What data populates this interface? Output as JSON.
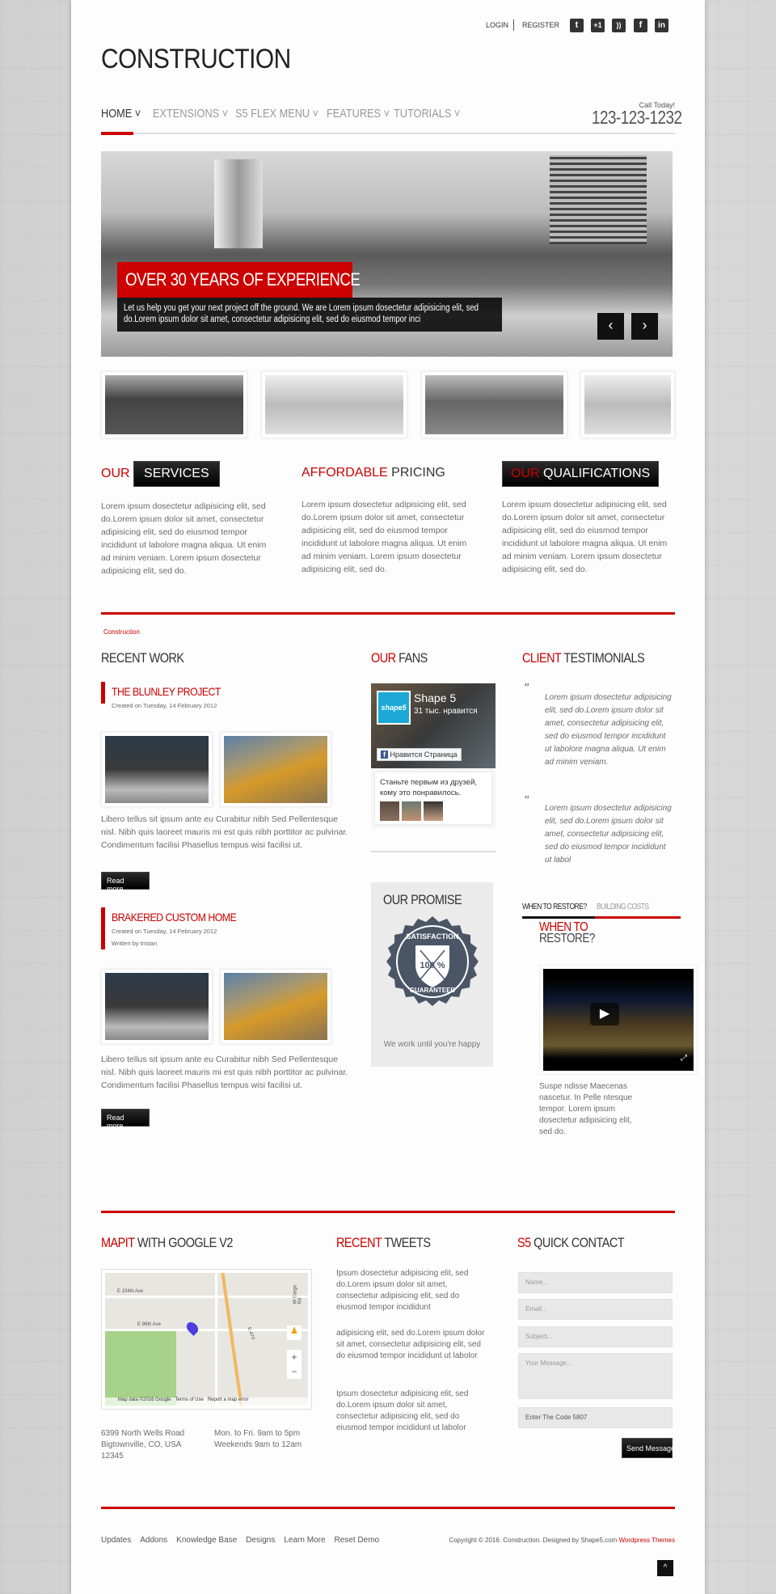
{
  "header": {
    "login": "LOGIN",
    "register": "REGISTER",
    "social": [
      "twitter-icon",
      "google-plus-icon",
      "rss-icon",
      "facebook-icon",
      "linkedin-icon"
    ],
    "logo": "CONSTRUCTION",
    "call_label": "Call Today!",
    "phone": "123-123-1232"
  },
  "nav": [
    {
      "label": "HOME",
      "active": true
    },
    {
      "label": "EXTENSIONS"
    },
    {
      "label": "S5 FLEX MENU"
    },
    {
      "label": "FEATURES"
    },
    {
      "label": "TUTORIALS"
    }
  ],
  "hero": {
    "title": "OVER 30 YEARS OF EXPERIENCE",
    "text": "Let us help you get your next project off the ground. We are Lorem ipsum dosectetur adipisicing elit, sed do.Lorem ipsum dolor sit amet, consectetur adipisicing elit, sed do eiusmod tempor inci"
  },
  "features": [
    {
      "accent": "OUR",
      "title": "SERVICES",
      "text": "Lorem ipsum dosectetur adipisicing elit, sed do.Lorem ipsum dolor sit amet, consectetur adipisicing elit, sed do eiusmod tempor incididunt ut labolore magna aliqua. Ut enim ad minim veniam. Lorem ipsum dosectetur adipisicing elit, sed do."
    },
    {
      "accent": "AFFORDABLE",
      "title": "PRICING",
      "text": "Lorem ipsum dosectetur adipisicing elit, sed do.Lorem ipsum dolor sit amet, consectetur adipisicing elit, sed do eiusmod tempor incididunt ut labolore magna aliqua. Ut enim ad minim veniam. Lorem ipsum dosectetur adipisicing elit, sed do."
    },
    {
      "accent": "OUR",
      "title": "QUALIFICATIONS",
      "text": "Lorem ipsum dosectetur adipisicing elit, sed do.Lorem ipsum dolor sit amet, consectetur adipisicing elit, sed do eiusmod tempor incididunt ut labolore magna aliqua. Ut enim ad minim veniam. Lorem ipsum dosectetur adipisicing elit, sed do."
    }
  ],
  "breadcrumb": "Construction",
  "recent_work": {
    "title": "RECENT WORK",
    "items": [
      {
        "title": "THE BLUNLEY PROJECT",
        "date": "Created on Tuesday, 14 February 2012",
        "text": "Libero tellus sit ipsum ante eu Curabitur nibh Sed Pellentesque nisl. Nibh quis laoreet mauris mi est quis nibh porttitor ac pulvinar. Condimentum facilisi Phasellus tempus wisi facilisi ut.",
        "button": "Read more..."
      },
      {
        "title": "BRAKERED CUSTOM HOME",
        "date": "Created on Tuesday, 14 February 2012",
        "author": "Written by tristan",
        "text": "Libero tellus sit ipsum ante eu Curabitur nibh Sed Pellentesque nisl. Nibh quis laoreet mauris mi est quis nibh porttitor ac pulvinar. Condimentum facilisi Phasellus tempus wisi facilisi ut.",
        "button": "Read more..."
      }
    ]
  },
  "fans": {
    "accent": "OUR",
    "title": "FANS",
    "page_name": "Shape 5",
    "likes": "31 тыс. нравится",
    "logo_text": "shape5",
    "like_button": "Нравится Страница",
    "friends_text": "Станьте первым из друзей, кому это понравилось."
  },
  "promise": {
    "title": "OUR PROMISE",
    "badge_top": "SATISFACTION",
    "badge_bottom": "GUARANTEED",
    "badge_mid": "100 %",
    "text": "We work until you're happy"
  },
  "testimonials": {
    "accent": "CLIENT",
    "title": "TESTIMONIALS",
    "items": [
      "Lorem ipsum dosectetur adipisicing elit, sed do.Lorem ipsum dolor sit amet, consectetur adipisicing elit, sed do eiusmod tempor incididunt ut labolore magna aliqua. Ut enim ad minim veniam.",
      "Lorem ipsum dosectetur adipisicing elit, sed do.Lorem ipsum dolor sit amet, consectetur adipisicing elit, sed do eiusmod tempor incididunt ut labol"
    ]
  },
  "tabs": {
    "items": [
      "WHEN TO RESTORE?",
      "BUILDING COSTS"
    ],
    "active": 0,
    "heading_accent": "WHEN TO",
    "heading": "RESTORE?",
    "text": "Suspe ndisse Maecenas nascetur. In Pelle ntesque tempor. Lorem ipsum dosectetur adipisicing elit, sed do."
  },
  "map": {
    "accent": "MAPIT",
    "title": "WITH GOOGLE V2",
    "labels": [
      "E 104th Ave",
      "E 96th Ave",
      "W Cargo Rd",
      "E-470"
    ],
    "attribution": "Map data ©2016 Google",
    "terms": "Terms of Use",
    "report": "Report a map error",
    "address": [
      "6399 North Wells Road",
      "Bigtownville, CO, USA",
      "12345"
    ],
    "hours": [
      "Mon. to Fri. 9am to 5pm",
      "Weekends 9am to 12am"
    ]
  },
  "tweets": {
    "accent": "RECENT",
    "title": "TWEETS",
    "items": [
      "Ipsum dosectetur adipisicing elit, sed do.Lorem ipsum dolor sit amet, consectetur adipisicing elit, sed do eiusmod tempor incididunt",
      "adipisicing elit, sed do.Lorem ipsum dolor sit amet, consectetur adipisicing elit, sed do eiusmod tempor incididunt ut labolor",
      "Ipsum dosectetur adipisicing elit, sed do.Lorem ipsum dolor sit amet, consectetur adipisicing elit, sed do eiusmod tempor incididunt ut labolor"
    ]
  },
  "contact": {
    "accent": "S5",
    "title": "QUICK CONTACT",
    "name": "Name...",
    "email": "Email...",
    "subject": "Subject...",
    "message": "Your Message...",
    "code": "Enter The Code 5807",
    "send": "Send Message"
  },
  "footer": {
    "links": [
      "Updates",
      "Addons",
      "Knowledge Base",
      "Designs",
      "Learn More",
      "Reset Demo"
    ],
    "copyright": "Copyright © 2016. Construction. Designed by Shape5.com",
    "copyright_link": "Wordpress Themes"
  },
  "colors": {
    "accent": "#cc0000",
    "dark": "#111111"
  }
}
